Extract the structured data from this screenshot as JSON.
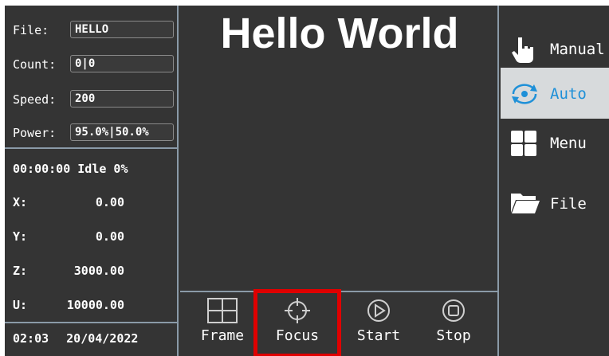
{
  "title": "Hello World",
  "fields": {
    "file": {
      "label": "File:",
      "value": "HELLO"
    },
    "count": {
      "label": "Count:",
      "value": "0|0"
    },
    "speed": {
      "label": "Speed:",
      "value": "200"
    },
    "power": {
      "label": "Power:",
      "value": "95.0%|50.0%"
    }
  },
  "status": "00:00:00 Idle 0%",
  "axes": [
    {
      "label": "X:",
      "value": "0.00"
    },
    {
      "label": "Y:",
      "value": "0.00"
    },
    {
      "label": "Z:",
      "value": "3000.00"
    },
    {
      "label": "U:",
      "value": "10000.00"
    }
  ],
  "footer": {
    "time": "02:03",
    "date": "20/04/2022"
  },
  "toolbar": {
    "frame": "Frame",
    "focus": "Focus",
    "start": "Start",
    "stop": "Stop"
  },
  "nav": {
    "manual": "Manual",
    "auto": "Auto",
    "menu": "Menu",
    "file": "File"
  },
  "colors": {
    "background": "#343434",
    "divider": "#8a9aa8",
    "active_nav_bg": "#d7dadc",
    "active_nav_text": "#1e90d8",
    "highlight": "#e00000"
  },
  "icons": [
    "hand-pointer-icon",
    "auto-cycle-icon",
    "grid-menu-icon",
    "folder-icon",
    "frame-icon",
    "crosshair-icon",
    "play-icon",
    "stop-icon"
  ]
}
